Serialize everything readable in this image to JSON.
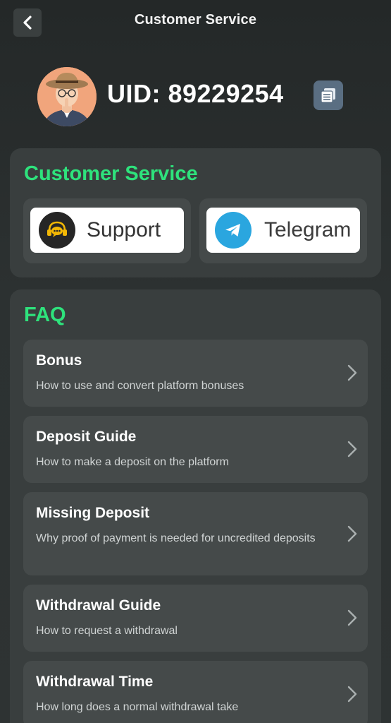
{
  "header": {
    "title": "Customer Service",
    "back_icon": "chevron-left-icon"
  },
  "profile": {
    "uid_text": "UID: 89229254",
    "copy_icon": "copy-icon"
  },
  "customer_service": {
    "title": "Customer Service",
    "buttons": [
      {
        "label": "Support",
        "icon": "headset-chat-icon"
      },
      {
        "label": "Telegram",
        "icon": "telegram-icon"
      }
    ]
  },
  "faq": {
    "title": "FAQ",
    "items": [
      {
        "question": "Bonus",
        "answer": "How to use and convert platform bonuses"
      },
      {
        "question": "Deposit Guide",
        "answer": "How to make a deposit on the platform"
      },
      {
        "question": "Missing Deposit",
        "answer": "Why proof of payment is needed for uncredited deposits"
      },
      {
        "question": "Withdrawal Guide",
        "answer": "How to request a withdrawal"
      },
      {
        "question": "Withdrawal Time",
        "answer": "How long does a normal withdrawal take"
      }
    ]
  },
  "colors": {
    "accent_green": "#2ee27c",
    "background": "#2b3030",
    "card": "#393e3e",
    "tile": "#454a4a",
    "telegram_blue": "#2aa6df"
  }
}
